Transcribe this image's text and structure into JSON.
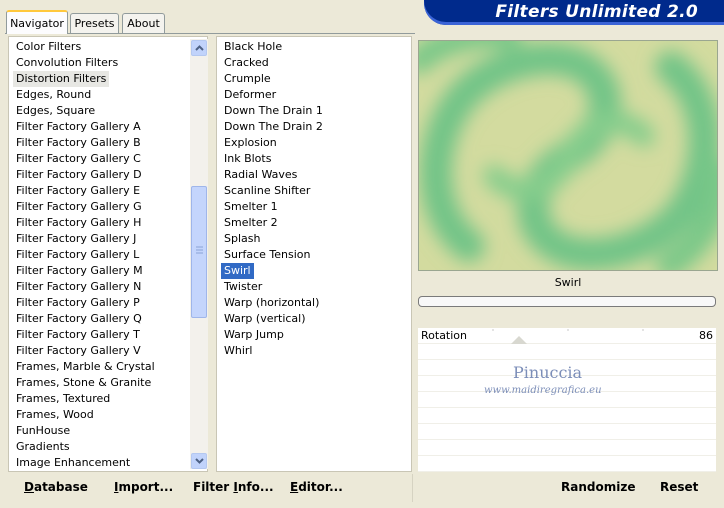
{
  "tabs": [
    "Navigator",
    "Presets",
    "About"
  ],
  "banner_title": "Filters Unlimited 2.0",
  "categories": [
    "Color Filters",
    "Convolution Filters",
    "Distortion Filters",
    "Edges, Round",
    "Edges, Square",
    "Filter Factory Gallery A",
    "Filter Factory Gallery B",
    "Filter Factory Gallery C",
    "Filter Factory Gallery D",
    "Filter Factory Gallery E",
    "Filter Factory Gallery G",
    "Filter Factory Gallery H",
    "Filter Factory Gallery J",
    "Filter Factory Gallery L",
    "Filter Factory Gallery M",
    "Filter Factory Gallery N",
    "Filter Factory Gallery P",
    "Filter Factory Gallery Q",
    "Filter Factory Gallery T",
    "Filter Factory Gallery V",
    "Frames, Marble & Crystal",
    "Frames, Stone & Granite",
    "Frames, Textured",
    "Frames, Wood",
    "FunHouse",
    "Gradients",
    "Image Enhancement"
  ],
  "selected_category": "Distortion Filters",
  "filters": [
    "Black Hole",
    "Cracked",
    "Crumple",
    "Deformer",
    "Down The Drain 1",
    "Down The Drain 2",
    "Explosion",
    "Ink Blots",
    "Radial Waves",
    "Scanline Shifter",
    "Smelter 1",
    "Smelter 2",
    "Splash",
    "Surface Tension",
    "Swirl",
    "Twister",
    "Warp (horizontal)",
    "Warp (vertical)",
    "Warp Jump",
    "Whirl"
  ],
  "selected_filter": "Swirl",
  "preview_filter_name": "Swirl",
  "params": [
    {
      "label": "Rotation",
      "value": "86",
      "slider_fraction": 0.34
    }
  ],
  "watermark": {
    "name": "Pinuccia",
    "url": "www.maidiregrafica.eu"
  },
  "buttons": {
    "database": {
      "u": "D",
      "rest": "atabase"
    },
    "import": {
      "u": "I",
      "rest": "mport..."
    },
    "filter_info": {
      "pre": "Filter ",
      "u": "I",
      "rest": "nfo..."
    },
    "editor": {
      "u": "E",
      "rest": "ditor..."
    },
    "randomize": "Randomize",
    "reset": "Reset"
  },
  "colors": {
    "banner": "#002a8c",
    "selection_blue": "#316ac5",
    "swirl_green": "#7ecb8a",
    "swirl_cream": "#d6dca0"
  },
  "icons": {
    "scroll_up": "chevron-up-icon",
    "scroll_down": "chevron-down-icon",
    "thumb_grip": "grip-icon"
  }
}
